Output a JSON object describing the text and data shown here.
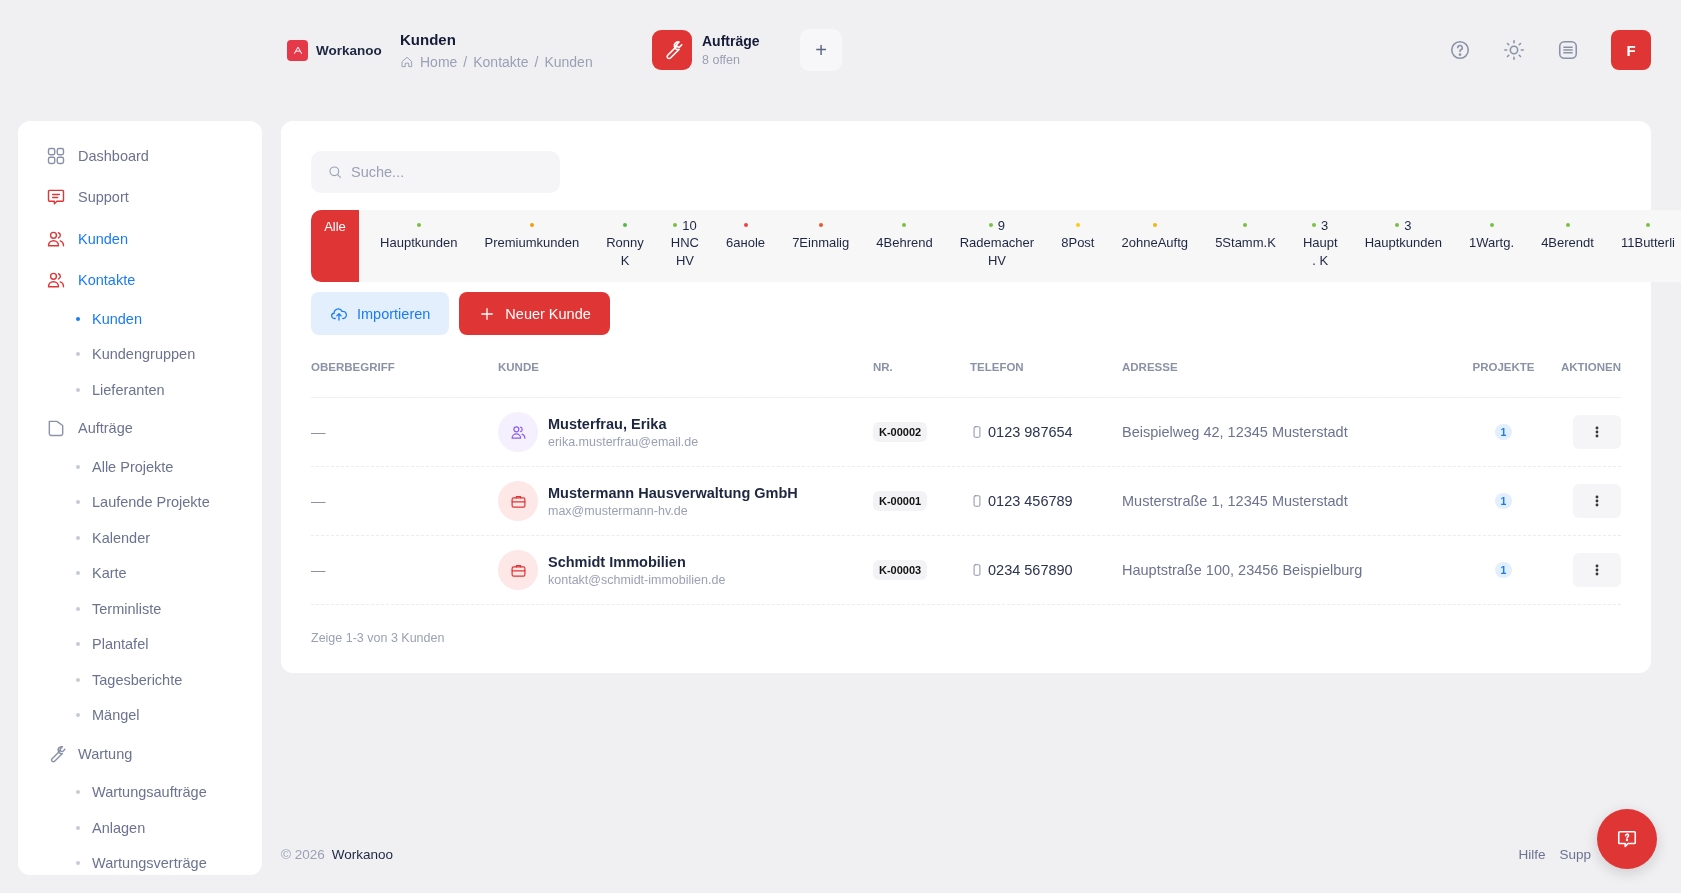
{
  "header": {
    "brand": "Workanoo",
    "page_title": "Kunden",
    "breadcrumb": [
      "Home",
      "Kontakte",
      "Kunden"
    ],
    "breadcrumb_separator": "/",
    "orders": {
      "label": "Aufträge",
      "sub": "8 offen"
    },
    "add_label": "+",
    "avatar": "F"
  },
  "sidebar": {
    "items": [
      {
        "label": "Dashboard",
        "selected": false
      },
      {
        "label": "Support",
        "selected": false
      },
      {
        "label": "Kunden",
        "selected": true
      },
      {
        "label": "Kontakte",
        "selected": true,
        "children": [
          {
            "label": "Kunden",
            "selected": true
          },
          {
            "label": "Kundengruppen",
            "selected": false
          },
          {
            "label": "Lieferanten",
            "selected": false
          }
        ]
      },
      {
        "label": "Aufträge",
        "selected": false,
        "children": [
          {
            "label": "Alle Projekte",
            "selected": false
          },
          {
            "label": "Laufende Projekte",
            "selected": false
          },
          {
            "label": "Kalender",
            "selected": false
          },
          {
            "label": "Karte",
            "selected": false
          },
          {
            "label": "Terminliste",
            "selected": false
          },
          {
            "label": "Plantafel",
            "selected": false
          },
          {
            "label": "Tagesberichte",
            "selected": false
          },
          {
            "label": "Mängel",
            "selected": false
          }
        ]
      },
      {
        "label": "Wartung",
        "selected": false,
        "children": [
          {
            "label": "Wartungsaufträge",
            "selected": false
          },
          {
            "label": "Anlagen",
            "selected": false
          },
          {
            "label": "Wartungsverträge",
            "selected": false
          }
        ]
      }
    ]
  },
  "search": {
    "placeholder": "Suche..."
  },
  "filters": [
    {
      "label": "Alle",
      "selected": true
    },
    {
      "label": "Hauptkunden",
      "color": "#7ac142",
      "selected": false
    },
    {
      "label": "Premiumkunden",
      "color": "#f59e0b",
      "selected": false
    },
    {
      "label": "Ronny K",
      "color": "#52b848",
      "selected": false
    },
    {
      "label": "HNC HV",
      "count": "10",
      "color": "#7ac142",
      "selected": false
    },
    {
      "label": "6aнole",
      "color": "#ef4444",
      "selected": false
    },
    {
      "label": "7Einmalig",
      "color": "#f2542d",
      "selected": false
    },
    {
      "label": "4Behrend",
      "color": "#7ac142",
      "selected": false
    },
    {
      "label": "Rademacher HV",
      "count": "9",
      "color": "#7ac142",
      "selected": false
    },
    {
      "label": "8Post",
      "color": "#facc15",
      "selected": false
    },
    {
      "label": "2ohneAuftg",
      "color": "#f5b50b",
      "selected": false
    },
    {
      "label": "5Stamm.K",
      "color": "#7ac142",
      "selected": false
    },
    {
      "label": "Haupt . K",
      "count": "3",
      "color": "#7ac142",
      "selected": false
    },
    {
      "label": "Hauptkunden",
      "count": "3",
      "color": "#7ac142",
      "selected": false
    },
    {
      "label": "1Wartg.",
      "color": "#7ac142",
      "selected": false
    },
    {
      "label": "4Berendt",
      "color": "#7ac142",
      "selected": false
    },
    {
      "label": "11Butterli",
      "color": "#7ac142",
      "selected": false
    }
  ],
  "actions": [
    {
      "label": "Importieren",
      "kind": "secondary"
    },
    {
      "label": "Neuer Kunde",
      "kind": "primary"
    }
  ],
  "table": {
    "columns": [
      "OBERBEGRIFF",
      "KUNDE",
      "NR.",
      "TELEFON",
      "ADRESSE",
      "PROJEKTE",
      "AKTIONEN"
    ],
    "rows": [
      {
        "oberbegriff": "—",
        "kind": "person",
        "name": "Musterfrau, Erika",
        "email": "erika.musterfrau@email.de",
        "nr": "K-00002",
        "telefon": "0123 987654",
        "adresse": "Beispielweg 42, 12345 Musterstadt",
        "projekte": "1"
      },
      {
        "oberbegriff": "—",
        "kind": "company",
        "name": "Mustermann Hausverwaltung GmbH",
        "email": "max@mustermann-hv.de",
        "nr": "K-00001",
        "telefon": "0123 456789",
        "adresse": "Musterstraße 1, 12345 Musterstadt",
        "projekte": "1"
      },
      {
        "oberbegriff": "—",
        "kind": "company",
        "name": "Schmidt Immobilien",
        "email": "kontakt@schmidt-immobilien.de",
        "nr": "K-00003",
        "telefon": "0234 567890",
        "adresse": "Hauptstraße 100, 23456 Beispielburg",
        "projekte": "1"
      }
    ],
    "summary": "Zeige 1-3 von 3 Kunden"
  },
  "footer": {
    "copyright": "© 2026",
    "brand": "Workanoo",
    "links": [
      "Hilfe",
      "Supp"
    ]
  }
}
